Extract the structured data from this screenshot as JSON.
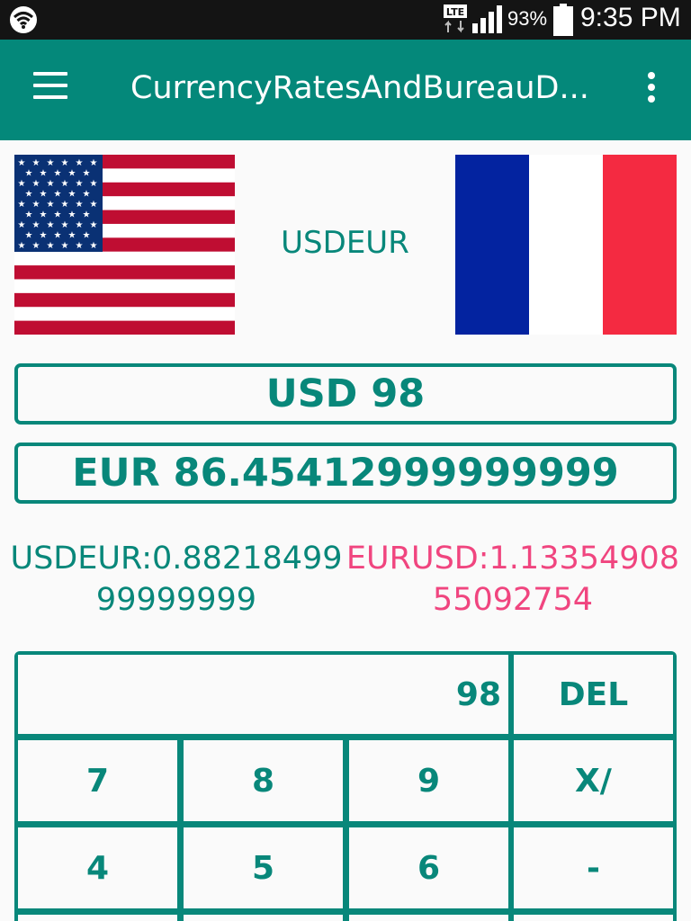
{
  "status_bar": {
    "network": "LTE",
    "battery_percent": "93%",
    "time": "9:35 PM"
  },
  "app_bar": {
    "title": "CurrencyRatesAndBureauD..."
  },
  "pair": {
    "label": "USDEUR",
    "from_flag": "us-flag",
    "to_flag": "france-flag"
  },
  "conversion": {
    "from_amount": "USD 98",
    "to_amount": "EUR 86.45412999999999"
  },
  "rates": {
    "forward": "USDEUR:0.8821849999999999",
    "inverse": "EURUSD:1.1335490855092754"
  },
  "keypad": {
    "display": "98",
    "del": "DEL",
    "row1": [
      "7",
      "8",
      "9",
      "X/"
    ],
    "row2": [
      "4",
      "5",
      "6",
      "-"
    ]
  },
  "colors": {
    "primary": "#04887a",
    "accent_text": "#08877a",
    "inverse_rate": "#f0457f",
    "status_bar": "#141414"
  }
}
